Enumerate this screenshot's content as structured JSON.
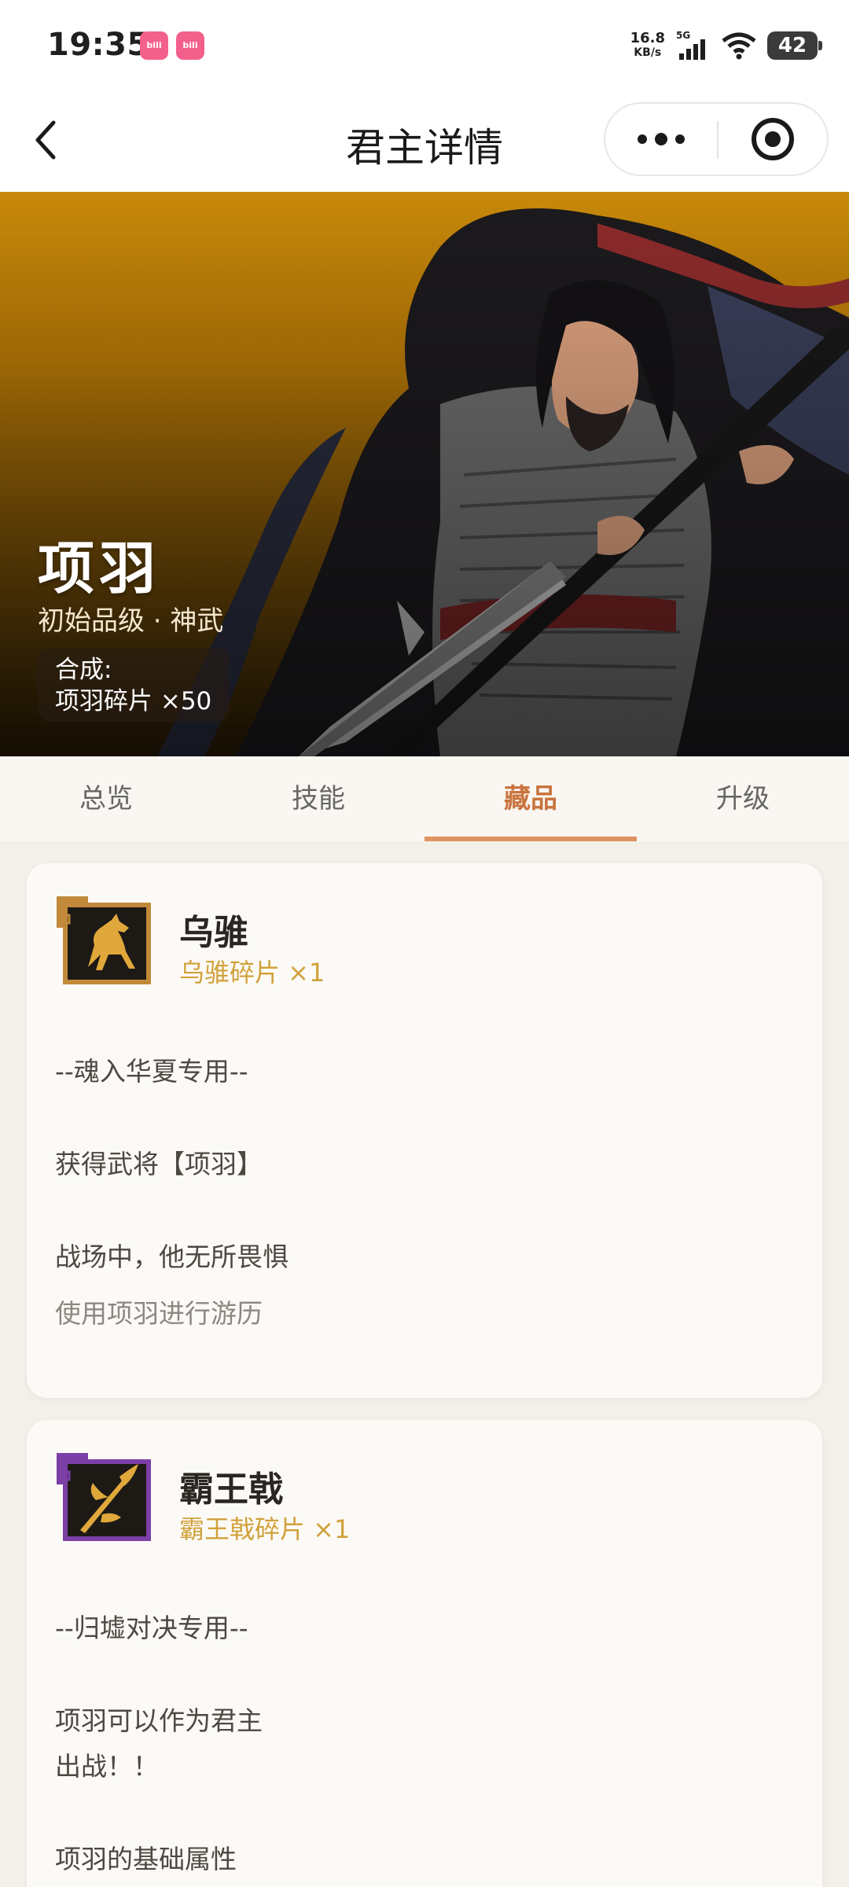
{
  "status_bar": {
    "time": "19:35",
    "app_icon_text": "哔哩哔哩",
    "net_speed_value": "16.8",
    "net_speed_unit": "KB/s",
    "network": "5G",
    "battery": "42"
  },
  "nav": {
    "title": "君主详情"
  },
  "hero": {
    "name": "项羽",
    "grade": "初始品级 · 神武",
    "synth_label": "合成:",
    "synth_value": "项羽碎片 ×50"
  },
  "tabs": [
    {
      "label": "总览",
      "active": false
    },
    {
      "label": "技能",
      "active": false
    },
    {
      "label": "藏品",
      "active": true
    },
    {
      "label": "升级",
      "active": false
    }
  ],
  "items": [
    {
      "title": "乌骓",
      "subtitle": "乌骓碎片 ×1",
      "icon": "horse-icon",
      "lines": [
        "--魂入华夏专用--",
        "获得武将【项羽】",
        "战场中，他无所畏惧"
      ],
      "footer": "使用项羽进行游历"
    },
    {
      "title": "霸王戟",
      "subtitle": "霸王戟碎片 ×1",
      "icon": "halberd-icon",
      "lines": [
        "--归墟对决专用--",
        "项羽可以作为君主",
        "出战！！",
        "项羽的基础属性"
      ]
    }
  ],
  "colors": {
    "accent": "#c8743f",
    "tab_underline": "#e0935f",
    "fragment_text": "#d1a13b",
    "hero_gold": "#c98a0a"
  }
}
